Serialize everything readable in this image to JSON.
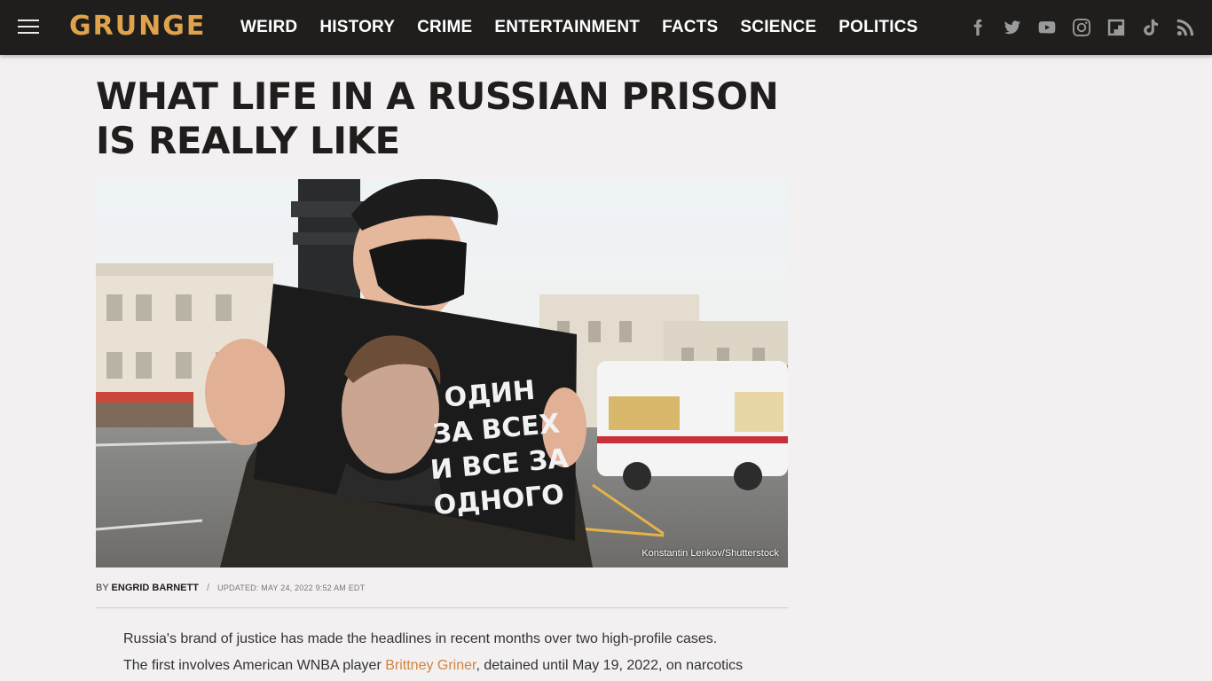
{
  "brand": {
    "logo_text": "GRUNGE",
    "accent_color": "#e0a34b",
    "header_bg": "#1f1e1c"
  },
  "nav": {
    "items": [
      "WEIRD",
      "HISTORY",
      "CRIME",
      "ENTERTAINMENT",
      "FACTS",
      "SCIENCE",
      "POLITICS"
    ]
  },
  "social": {
    "icons": [
      "facebook-icon",
      "twitter-icon",
      "youtube-icon",
      "instagram-icon",
      "flipboard-icon",
      "tiktok-icon",
      "rss-icon"
    ]
  },
  "article": {
    "headline": "WHAT LIFE IN A RUSSIAN PRISON IS REALLY LIKE",
    "image_credit": "Konstantin Lenkov/Shutterstock",
    "sign_text": [
      "ОДИН",
      "ЗА ВСЕХ",
      "И ВСЕ ЗА",
      "ОДНОГО"
    ],
    "byline_prefix": "BY",
    "author": "ENGRID BARNETT",
    "separator": "/",
    "updated": "UPDATED: MAY 24, 2022 9:52 AM EDT",
    "para1_line1": "Russia's brand of justice has made the headlines in recent months over two high-profile cases.",
    "para1_line2_pre": "The first involves American WNBA player ",
    "para1_link": "Brittney Griner",
    "para1_line2_post": ", detained until May 19, 2022, on narcotics",
    "link_color": "#d2843f"
  }
}
